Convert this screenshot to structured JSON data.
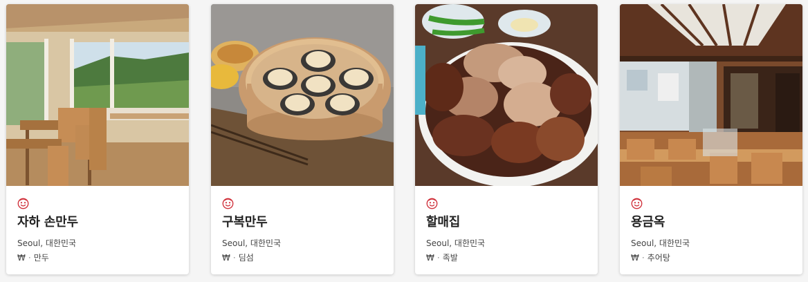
{
  "cards": [
    {
      "title": "자하 손만두",
      "location": "Seoul, 대한민국",
      "price": "₩",
      "separator": "·",
      "cuisine": "만두",
      "icon": "michelin-bib-gourmand-icon",
      "image": "dining-room-window-view-photo"
    },
    {
      "title": "구복만두",
      "location": "Seoul, 대한민국",
      "price": "₩",
      "separator": "·",
      "cuisine": "딤섬",
      "icon": "michelin-bib-gourmand-icon",
      "image": "steamed-dumplings-photo"
    },
    {
      "title": "할매집",
      "location": "Seoul, 대한민국",
      "price": "₩",
      "separator": "·",
      "cuisine": "족발",
      "icon": "michelin-bib-gourmand-icon",
      "image": "braised-pork-trotters-photo"
    },
    {
      "title": "용금옥",
      "location": "Seoul, 대한민국",
      "price": "₩",
      "separator": "·",
      "cuisine": "추어탕",
      "icon": "michelin-bib-gourmand-icon",
      "image": "restaurant-interior-photo"
    }
  ],
  "colors": {
    "bib_red": "#d0303a",
    "title": "#222222",
    "text": "#444444"
  }
}
